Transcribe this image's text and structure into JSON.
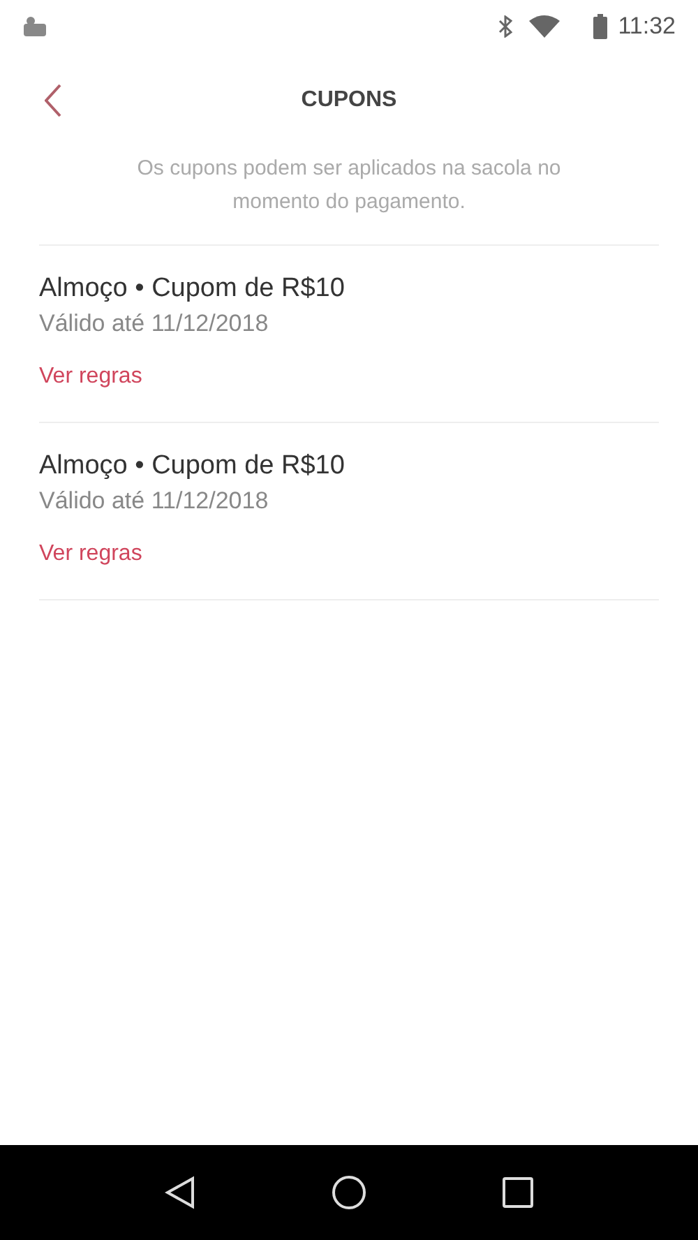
{
  "status_bar": {
    "time": "11:32"
  },
  "header": {
    "title": "CUPONS"
  },
  "subtitle": "Os cupons podem ser aplicados na sacola no momento do pagamento.",
  "coupons": [
    {
      "title": "Almoço • Cupom de R$10",
      "validity": "Válido até 11/12/2018",
      "link": "Ver regras"
    },
    {
      "title": "Almoço • Cupom de R$10",
      "validity": "Válido até 11/12/2018",
      "link": "Ver regras"
    }
  ]
}
